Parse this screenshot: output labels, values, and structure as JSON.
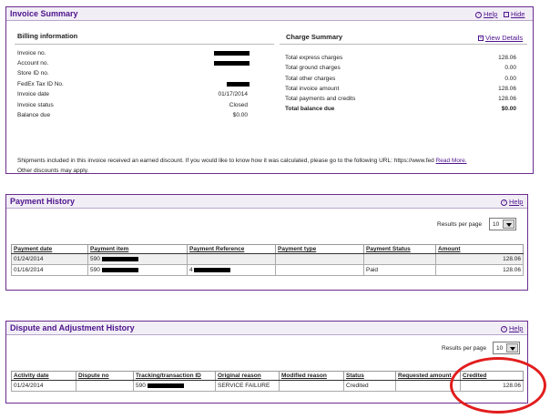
{
  "invoice_summary": {
    "title": "Invoice Summary",
    "help": "Help",
    "hide": "Hide",
    "billing": {
      "title": "Billing information",
      "rows": [
        {
          "label": "Invoice no.",
          "value": "",
          "redacted": true
        },
        {
          "label": "Account no.",
          "value": "",
          "redacted": true
        },
        {
          "label": "Store ID no.",
          "value": ""
        },
        {
          "label": "FedEx Tax ID No.",
          "value": "",
          "redacted": true
        },
        {
          "label": "Invoice date",
          "value": "01/17/2014"
        },
        {
          "label": "Invoice status",
          "value": "Closed"
        },
        {
          "label": "Balance due",
          "value": "$0.00"
        }
      ]
    },
    "charges": {
      "title": "Charge Summary",
      "view_details": "View Details",
      "rows": [
        {
          "label": "Total express charges",
          "value": "128.06"
        },
        {
          "label": "Total ground charges",
          "value": "0.00"
        },
        {
          "label": "Total other charges",
          "value": "0.00"
        },
        {
          "label": "Total invoice amount",
          "value": "128.06"
        },
        {
          "label": "Total payments and credits",
          "value": "128.06"
        },
        {
          "label": "Total balance due",
          "value": "$0.00"
        }
      ]
    },
    "note1": "Shipments included in this invoice received an earned discount. If you would like to know how it was calculated, please go to the following URL: https://www.fed",
    "read_more": "Read More.",
    "note2": "Other discounts may apply."
  },
  "payment_history": {
    "title": "Payment History",
    "help": "Help",
    "rpp_label": "Results per page",
    "rpp_value": "10",
    "columns": [
      "Payment date",
      "Payment item",
      "Payment Reference",
      "Payment type",
      "Payment Status",
      "Amount"
    ],
    "rows": [
      {
        "date": "01/24/2014",
        "item": "590",
        "reference": "",
        "type": "",
        "status": "",
        "amount": "128.06"
      },
      {
        "date": "01/16/2014",
        "item": "590",
        "reference": "4",
        "type": "",
        "status": "Paid",
        "amount": "128.06"
      }
    ]
  },
  "dispute_history": {
    "title": "Dispute and Adjustment History",
    "help": "Help",
    "rpp_label": "Results per page",
    "rpp_value": "10",
    "columns": [
      "Activity date",
      "Dispute no",
      "Tracking/transaction ID",
      "Original reason",
      "Modified reason",
      "Status",
      "Requested amount",
      "Credited"
    ],
    "rows": [
      {
        "date": "01/24/2014",
        "dispute_no": "",
        "tracking": "590",
        "original_reason": "SERVICE FAILURE",
        "modified_reason": "",
        "status": "Credited",
        "requested": "",
        "credited": "128.06"
      }
    ]
  },
  "colors": {
    "brand": "#4d148c",
    "annotation": "#e21d1d"
  }
}
